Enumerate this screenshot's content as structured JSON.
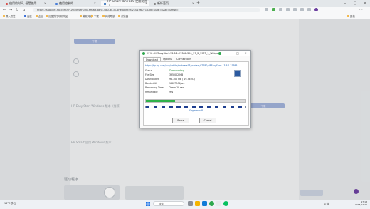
{
  "browser": {
    "tabs": [
      {
        "label": "使用的时间, 但是使用",
        "active": false
      },
      {
        "label": "使用控制的",
        "active": false
      },
      {
        "label": "HP Smart Tank 580 使用说明（…",
        "active": true
      },
      {
        "label": "新标签页",
        "active": false
      }
    ],
    "url": "https://support.hp.com/cn-zh/drivers/hp-smart-tank-580-all-in-one-printer/2101960712/id=1&dl=&sel=&msf=",
    "bookmarks": [
      "导入书签",
      "百度",
      "企业",
      "优惠的打印机商品",
      "微软网络",
      "下载",
      "网络导航",
      "浏览器",
      "其他"
    ]
  },
  "dialog": {
    "title": "29% - HPEasyStart-13.6.1-27386-390_57_2_1973_1_Webpack.exe",
    "tabs": [
      "Download",
      "Options",
      "Connections"
    ],
    "url": "https://ftp.hp.com/pub/softlib/software13/printers/STS80/HPEasyStart-13.6.1-27386-390_57_2",
    "rows": [
      {
        "label": "Status",
        "value": "Downloading..."
      },
      {
        "label": "File Size",
        "value": "335.002 MB"
      },
      {
        "label": "Downloaded",
        "value": "98.300 MB ( 29.36 % )"
      },
      {
        "label": "Bandwidth",
        "value": "1.807 MB/sec"
      },
      {
        "label": "Remaining Time",
        "value": "2 min 19 sec"
      },
      {
        "label": "Resumable",
        "value": "Yes"
      }
    ],
    "progress_fraction": 0.2936,
    "segments": [
      1,
      0,
      1,
      0,
      1,
      0,
      1,
      0,
      1,
      0,
      1,
      0,
      1,
      0,
      1,
      0,
      1,
      0,
      1,
      0,
      1,
      0,
      1,
      0,
      1,
      0
    ],
    "connections_label": "Segments 8",
    "pause_label": "Pause",
    "cancel_label": "Cancel"
  },
  "page": {
    "section_heading": "驱动程序",
    "para_texts": [
      "HP Easy Start Windows 版本（推荐）",
      "HP Smart 应用 Windows 版本"
    ],
    "download_label": "下载"
  },
  "taskbar": {
    "weather": "18°C 多云",
    "search_placeholder": "搜索",
    "tray": "中 英",
    "time": "17:18",
    "date": "2023/12/29"
  },
  "colors": {
    "progress": "#31b24a",
    "segment": "#1f3f8f",
    "link": "#1a5fb4",
    "avatar": "#6b3fa0"
  }
}
